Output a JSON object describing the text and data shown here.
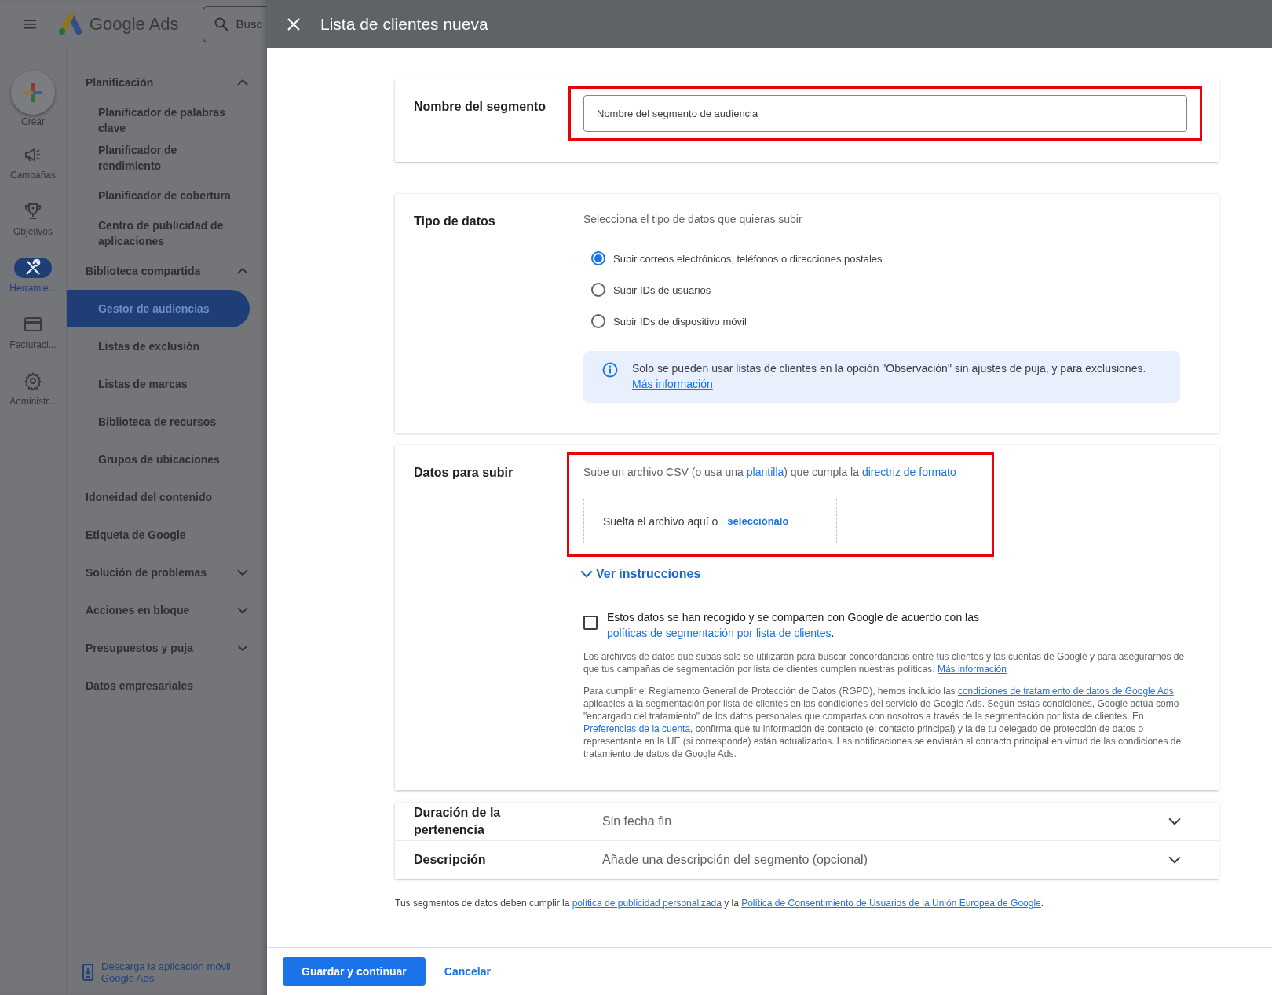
{
  "app_bar": {
    "logo_text": "Google Ads",
    "search_placeholder": "Busc"
  },
  "rail": [
    {
      "label": "Crear",
      "kind": "create"
    },
    {
      "label": "Campañas",
      "kind": "megaphone",
      "selected": false
    },
    {
      "label": "Objetivos",
      "kind": "trophy",
      "selected": false
    },
    {
      "label": "Herramie...",
      "kind": "tools",
      "selected": true
    },
    {
      "label": "Facturaci...",
      "kind": "card",
      "selected": false
    },
    {
      "label": "Administr...",
      "kind": "gear",
      "selected": false
    }
  ],
  "nav": [
    {
      "label": "Planificación",
      "kind": "group",
      "expanded": true,
      "children": [
        {
          "label": "Planificador de palabras clave",
          "selected": false
        },
        {
          "label": "Planificador de rendimiento",
          "selected": false
        },
        {
          "label": "Planificador de cobertura",
          "selected": false
        },
        {
          "label": "Centro de publicidad de aplicaciones",
          "selected": false
        }
      ]
    },
    {
      "label": "Biblioteca compartida",
      "kind": "group",
      "expanded": true,
      "children": [
        {
          "label": "Gestor de audiencias",
          "selected": true
        },
        {
          "label": "Listas de exclusión",
          "selected": false
        },
        {
          "label": "Listas de marcas",
          "selected": false
        },
        {
          "label": "Biblioteca de recursos",
          "selected": false
        },
        {
          "label": "Grupos de ubicaciones",
          "selected": false
        }
      ]
    },
    {
      "label": "Idoneidad del contenido",
      "kind": "link"
    },
    {
      "label": "Etiqueta de Google",
      "kind": "link"
    },
    {
      "label": "Solución de problemas",
      "kind": "group",
      "expanded": false
    },
    {
      "label": "Acciones en bloque",
      "kind": "group",
      "expanded": false
    },
    {
      "label": "Presupuestos y puja",
      "kind": "group",
      "expanded": false
    },
    {
      "label": "Datos empresariales",
      "kind": "link"
    }
  ],
  "download_app": "Descarga la aplicación móvil Google Ads",
  "dialog": {
    "title": "Lista de clientes nueva"
  },
  "segment_name": {
    "label": "Nombre del segmento",
    "placeholder": "Nombre del segmento de audiencia",
    "highlighted": true
  },
  "data_type": {
    "label": "Tipo de datos",
    "prompt": "Selecciona el tipo de datos que quieras subir",
    "options": [
      {
        "label": "Subir correos electrónicos, teléfonos o direcciones postales",
        "selected": true
      },
      {
        "label": "Subir IDs de usuarios",
        "selected": false
      },
      {
        "label": "Subir IDs de dispositivo móvil",
        "selected": false
      }
    ],
    "notice": [
      {
        "kind": "text",
        "text": "Solo se pueden usar listas de clientes en la opción \"Observación\" sin ajustes de puja, y para exclusiones. "
      },
      {
        "kind": "link",
        "text": "Más información"
      }
    ]
  },
  "upload": {
    "label": "Datos para subir",
    "highlighted": true,
    "intro": [
      {
        "kind": "text",
        "text": "Sube un archivo CSV (o usa una "
      },
      {
        "kind": "link",
        "text": "plantilla"
      },
      {
        "kind": "text",
        "text": ") que cumpla la "
      },
      {
        "kind": "link",
        "text": "directriz de formato"
      }
    ],
    "drop_text": "Suelta el archivo aquí o",
    "drop_link": "selecciónalo",
    "instructions": "Ver instrucciones",
    "consent": {
      "checked": false,
      "parts": [
        {
          "kind": "text",
          "text": "Estos datos se han recogido y se comparten con Google de acuerdo con las "
        },
        {
          "kind": "link",
          "text": "políticas de segmentación por lista de clientes"
        },
        {
          "kind": "text",
          "text": "."
        }
      ]
    },
    "paragraphs": [
      [
        {
          "kind": "text",
          "text": "Los archivos de datos que subas solo se utilizarán para buscar concordancias entre tus clientes y las cuentas de Google y para asegurarnos de que tus campañas de segmentación por lista de clientes cumplen nuestras políticas. "
        },
        {
          "kind": "link",
          "text": "Más información"
        }
      ],
      [
        {
          "kind": "text",
          "text": "Para cumplir el Reglamento General de Protección de Datos (RGPD), hemos incluido las "
        },
        {
          "kind": "link",
          "text": "condiciones de tratamiento de datos de Google Ads"
        },
        {
          "kind": "text",
          "text": " aplicables a la segmentación por lista de clientes en las condiciones del servicio de Google Ads. Según estas condiciones, Google actúa como \"encargado del tratamiento\" de los datos personales que compartas con nosotros a través de la segmentación por lista de clientes. En "
        },
        {
          "kind": "link",
          "text": "Preferencias de la cuenta"
        },
        {
          "kind": "text",
          "text": ", confirma que tu información de contacto (el contacto principal) y la de tu delegado de protección de datos o representante en la UE (si corresponde) están actualizados. Las notificaciones se enviarán al contacto principal en virtud de las condiciones de tratamiento de datos de Google Ads."
        }
      ]
    ]
  },
  "settings_rows": [
    {
      "label": "Duración de la pertenencia",
      "value": "Sin fecha fin"
    },
    {
      "label": "Descripción",
      "value": "Añade una descripción del segmento (opcional)"
    }
  ],
  "footer_note": [
    {
      "kind": "text",
      "text": "Tus segmentos de datos deben cumplir la "
    },
    {
      "kind": "link",
      "text": "política de publicidad personalizada"
    },
    {
      "kind": "text",
      "text": " y la "
    },
    {
      "kind": "link",
      "text": "Política de Consentimiento de Usuarios de la Unión Europea de Google"
    },
    {
      "kind": "text",
      "text": "."
    }
  ],
  "actions": {
    "primary": "Guardar y continuar",
    "secondary": "Cancelar"
  }
}
